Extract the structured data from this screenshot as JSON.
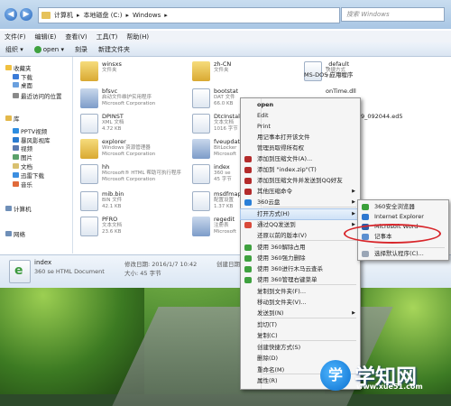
{
  "address": {
    "path": [
      "计算机",
      "本地磁盘 (C:)",
      "Windows"
    ],
    "search_placeholder": "搜索 Windows"
  },
  "menu": [
    "文件(F)",
    "编辑(E)",
    "查看(V)",
    "工具(T)",
    "帮助(H)"
  ],
  "toolbar": {
    "organize": "组织 ▾",
    "open": "open ▾",
    "burn": "刻录",
    "new_folder": "新建文件夹"
  },
  "sidebar": [
    {
      "label": "收藏夹",
      "color": "#f0c040"
    },
    {
      "label": "下载",
      "color": "#3b7bd8"
    },
    {
      "label": "桌面",
      "color": "#6aa0de"
    },
    {
      "label": "最近访问的位置",
      "color": "#8a8a8a"
    },
    {
      "label": "库",
      "color": "#e3b84a"
    },
    {
      "label": "PPTV视频",
      "color": "#2d8de0"
    },
    {
      "label": "暴风影视库",
      "color": "#2a7bd0"
    },
    {
      "label": "视频",
      "color": "#5b7ab0"
    },
    {
      "label": "图片",
      "color": "#5aa16a"
    },
    {
      "label": "文档",
      "color": "#d8c070"
    },
    {
      "label": "迅雷下载",
      "color": "#3c8ee0"
    },
    {
      "label": "音乐",
      "color": "#e06a3a"
    },
    {
      "label": "计算机",
      "color": "#6f8fb8"
    },
    {
      "label": "网络",
      "color": "#6f8fb8"
    }
  ],
  "files": [
    {
      "name": "winsxs",
      "sub1": "文件夹",
      "sub2": "",
      "kind": "folder"
    },
    {
      "name": "bfsvc",
      "sub1": "启动文件维护实用程序",
      "sub2": "Microsoft Corporation",
      "kind": "exe"
    },
    {
      "name": "DPINST",
      "sub1": "XML 文档",
      "sub2": "4.72 KB",
      "kind": "doc"
    },
    {
      "name": "explorer",
      "sub1": "Windows 资源管理器",
      "sub2": "Microsoft Corporation",
      "kind": "folder"
    },
    {
      "name": "hh",
      "sub1": "Microsoft® HTML 帮助可执行程序",
      "sub2": "Microsoft Corporation",
      "kind": "doc"
    },
    {
      "name": "mib.bin",
      "sub1": "BIN 文件",
      "sub2": "42.1 KB",
      "kind": "doc"
    },
    {
      "name": "PFRO",
      "sub1": "文本文档",
      "sub2": "23.6 KB",
      "kind": "doc"
    },
    {
      "name": "zh-CN",
      "sub1": "文件夹",
      "sub2": "",
      "kind": "folder"
    },
    {
      "name": "bootstat",
      "sub1": "DAT 文件",
      "sub2": "66.0 KB",
      "kind": "doc"
    },
    {
      "name": "DtcInstall",
      "sub1": "文本文档",
      "sub2": "1016 字节",
      "kind": "doc"
    },
    {
      "name": "fveupdate",
      "sub1": "BitLocker",
      "sub2": "Microsoft",
      "kind": "exe"
    },
    {
      "name": "index",
      "sub1": "360 se",
      "sub2": "45 字节",
      "kind": "doc"
    },
    {
      "name": "msdfmap",
      "sub1": "配置设置",
      "sub2": "1.37 KB",
      "kind": "doc"
    },
    {
      "name": "regedit",
      "sub1": "注册表",
      "sub2": "Microsoft",
      "kind": "exe"
    },
    {
      "name": "_default",
      "sub1": "快捷方式",
      "sub2": "707 字节",
      "kind": "doc"
    },
    {
      "name": "MS-DOS 应用程序",
      "sub1": "",
      "sub2": "",
      "kind": "doc"
    },
    {
      "name": "onTime.dll",
      "sub1": "",
      "sub2": "",
      "kind": "doc"
    },
    {
      "name": "20151229_092044.ed5",
      "sub1": "",
      "sub2": "",
      "kind": "doc"
    }
  ],
  "status": {
    "name": "index",
    "type": "360 se HTML Document",
    "modified": "修改日期: 2016/1/7 10:42",
    "created": "创建日期: 2013/4/20",
    "size": "大小: 45 字节"
  },
  "context_menu": {
    "items": [
      "open",
      "Edit",
      "Print",
      "用记事本打开该文件",
      "管理员取得所有权",
      "添加到压缩文件(A)...",
      "添加到 \"index.zip\"(T)",
      "添加到压缩文件并发送到QQ好友",
      "其他压缩命令",
      "360云盘",
      "打开方式(H)",
      "通过QQ发送到",
      "还原以前的版本(V)",
      "使用 360解除占用",
      "使用 360强力删除",
      "使用 360进行木马云查杀",
      "使用 360管理右键菜单",
      "复制到文件夹(F)...",
      "移动到文件夹(V)...",
      "发送到(N)",
      "剪切(T)",
      "复制(C)",
      "创建快捷方式(S)",
      "删除(D)",
      "重命名(M)",
      "属性(R)"
    ],
    "hover": "打开方式(H)"
  },
  "open_with_menu": {
    "items": [
      "360安全浏览器",
      "Internet Explorer",
      "Microsoft Word",
      "记事本",
      "选择默认程序(C)..."
    ],
    "highlight": "记事本"
  },
  "watermark": {
    "logo": "学",
    "text": "学知网",
    "url": "www.xue51.com"
  }
}
